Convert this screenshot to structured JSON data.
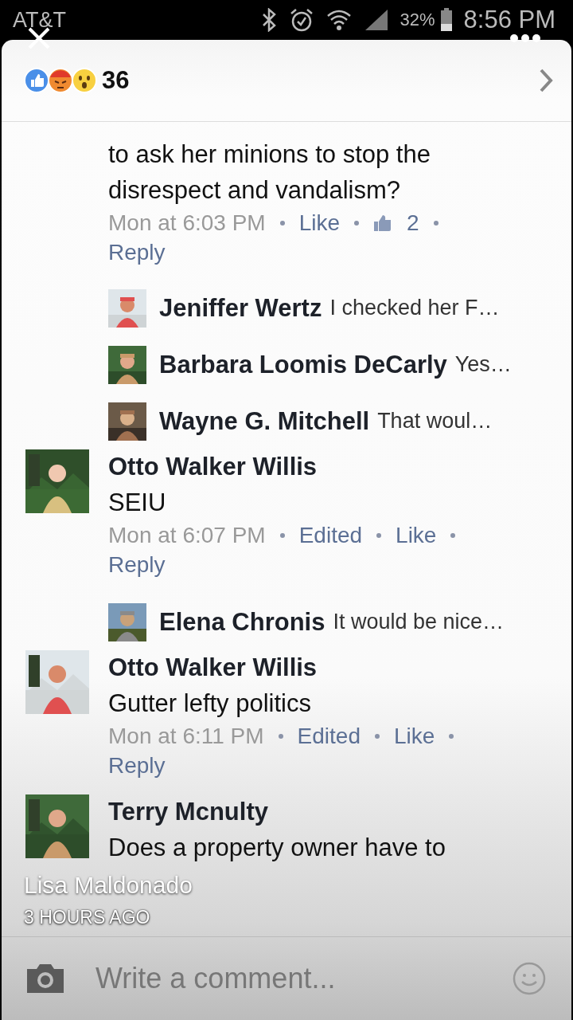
{
  "status_bar": {
    "carrier": "AT&T",
    "battery": "32%",
    "time": "8:56 PM"
  },
  "header": {
    "reaction_count": "36"
  },
  "items": [
    {
      "kind": "tail",
      "text": "to ask her minions to stop the disrespect and vandalism?",
      "time": "Mon at 6:03 PM",
      "like": "Like",
      "like_count": "2",
      "reply": "Reply"
    },
    {
      "kind": "reply",
      "author": "Jeniffer Wertz",
      "text": "I checked her F…"
    },
    {
      "kind": "reply",
      "author": "Barbara Loomis DeCarly",
      "text": "Yes…"
    },
    {
      "kind": "reply",
      "author": "Wayne G. Mitchell",
      "text": "That woul…"
    },
    {
      "kind": "comment",
      "author": "Otto Walker Willis",
      "text": "SEIU",
      "time": "Mon at 6:07 PM",
      "edited": "Edited",
      "like": "Like",
      "reply": "Reply"
    },
    {
      "kind": "reply",
      "author": "Elena Chronis",
      "text": "It would be nice…"
    },
    {
      "kind": "comment",
      "author": "Otto Walker Willis",
      "text": "Gutter lefty politics",
      "time": "Mon at 6:11 PM",
      "edited": "Edited",
      "like": "Like",
      "reply": "Reply"
    },
    {
      "kind": "comment",
      "author": "Terry Mcnulty",
      "text": "Does a property owner have to"
    }
  ],
  "composer": {
    "placeholder": "Write a comment..."
  },
  "story_overlay": {
    "author": "Lisa Maldonado",
    "age": "3 HOURS AGO"
  }
}
